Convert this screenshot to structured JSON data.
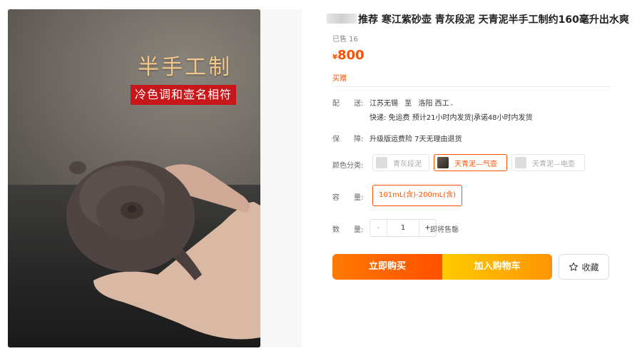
{
  "photo": {
    "headline": "半手工制",
    "tagline": "冷色调和壶名相符"
  },
  "product": {
    "title": "推荐 寒江紫砂壶 青灰段泥 天青泥半手工制约160毫升出水爽",
    "sold": "已售 16",
    "currency": "¥",
    "price": "800",
    "buy_gift": "买赠"
  },
  "shipping": {
    "label": "配　　送:",
    "route_from": "江苏无锡",
    "route_to": "至",
    "destination": "洛阳 西工",
    "detail": "快递: 免运费  预计21小时内发货|承诺48小时内发货"
  },
  "guarantee": {
    "label": "保　　障:",
    "value": "升级版运费险 7天无理由退货"
  },
  "color": {
    "label": "颜色分类:",
    "options": [
      {
        "label": "青灰段泥",
        "selected": false
      },
      {
        "label": "天青泥—气壶",
        "selected": true
      },
      {
        "label": "天青泥—电壶",
        "selected": false
      }
    ]
  },
  "capacity": {
    "label": "容　　量:",
    "option": "101mL(含)-200mL(含)"
  },
  "quantity": {
    "label": "数　　量:",
    "minus": "-",
    "value": "1",
    "plus": "+",
    "stock": "即将售罄"
  },
  "actions": {
    "buy_now": "立即购买",
    "add_cart": "加入购物车",
    "favorite": "收藏"
  },
  "colors": {
    "accent": "#ff5000",
    "buy_gradient": "#ff7a00",
    "cart_gradient": "#ffcb00"
  }
}
